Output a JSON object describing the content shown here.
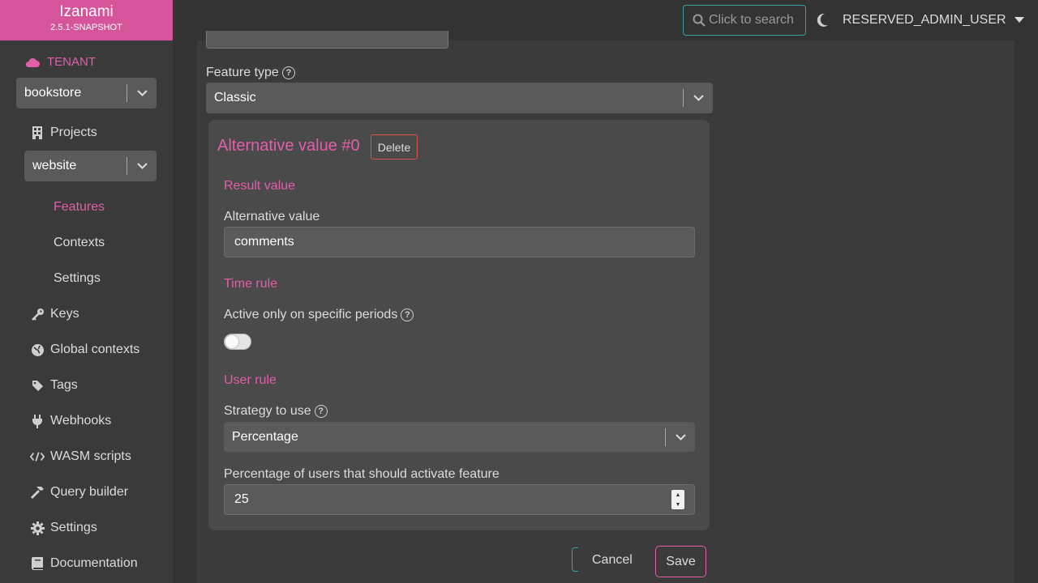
{
  "app": {
    "name": "Izanami",
    "version": "2.5.1-SNAPSHOT"
  },
  "topbar": {
    "search_label": "Click to search",
    "user": "RESERVED_ADMIN_USER"
  },
  "sidebar": {
    "tenant_label": "TENANT",
    "tenant_value": "bookstore",
    "projects_label": "Projects",
    "project_value": "website",
    "project_items": [
      {
        "label": "Features",
        "active": true
      },
      {
        "label": "Contexts",
        "active": false
      },
      {
        "label": "Settings",
        "active": false
      }
    ],
    "items": [
      {
        "label": "Keys",
        "icon": "key-icon"
      },
      {
        "label": "Global contexts",
        "icon": "globe-icon"
      },
      {
        "label": "Tags",
        "icon": "tag-icon"
      },
      {
        "label": "Webhooks",
        "icon": "plug-icon"
      },
      {
        "label": "WASM scripts",
        "icon": "code-icon"
      },
      {
        "label": "Query builder",
        "icon": "hammer-icon"
      },
      {
        "label": "Settings",
        "icon": "gear-icon"
      },
      {
        "label": "Documentation",
        "icon": "book-icon"
      }
    ]
  },
  "form": {
    "feature_type_label": "Feature type",
    "feature_type_value": "Classic",
    "alternative": {
      "title": "Alternative value #0",
      "delete_label": "Delete",
      "result_section": "Result value",
      "alt_value_label": "Alternative value",
      "alt_value": "comments",
      "time_section": "Time rule",
      "periods_label": "Active only on specific periods",
      "periods_enabled": false,
      "user_section": "User rule",
      "strategy_label": "Strategy to use",
      "strategy_value": "Percentage",
      "percentage_label": "Percentage of users that should activate feature",
      "percentage_value": "25"
    },
    "cancel_label": "Cancel",
    "save_label": "Save"
  },
  "colors": {
    "accent": "#e05fa8",
    "brand": "#d5549a",
    "teal": "#3aa0a8",
    "danger": "#d9534f"
  }
}
